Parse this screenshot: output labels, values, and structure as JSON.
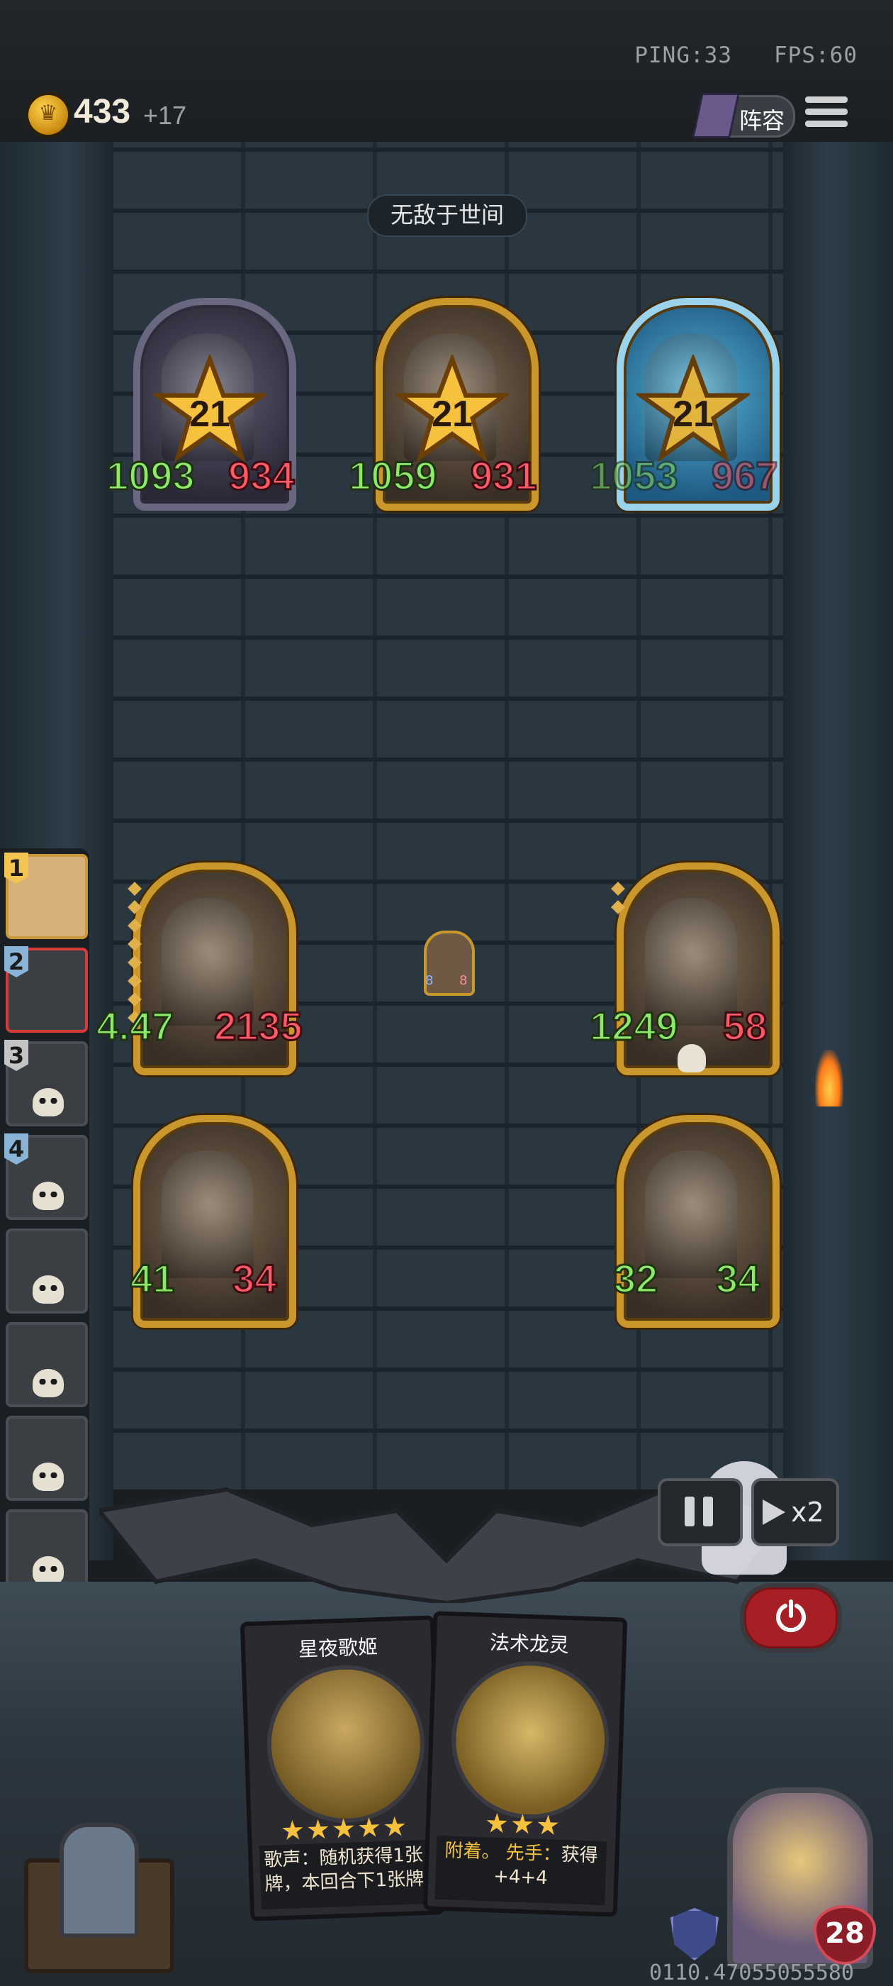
{
  "status": {
    "ping": "PING:33",
    "fps": "FPS:60"
  },
  "economy": {
    "gold": "433",
    "gold_income": "+17",
    "coin_icon": "crown-coin-icon"
  },
  "topbar": {
    "lineup_label": "阵容",
    "menu_icon": "hamburger-menu-icon"
  },
  "board_title": "无敌于世间",
  "enemy_units": [
    {
      "level": "21",
      "attack": "1093",
      "health": "934",
      "frame": "purple"
    },
    {
      "level": "21",
      "attack": "1059",
      "health": "931",
      "frame": "gold"
    },
    {
      "level": "21",
      "attack": "1053",
      "health": "967",
      "frame": "frozen"
    }
  ],
  "player_units": [
    {
      "attack": "4.47",
      "health": "2135"
    },
    {
      "attack": "1249",
      "health": "58"
    },
    {
      "attack": "41",
      "health": "34"
    },
    {
      "attack": "32",
      "health": "34"
    }
  ],
  "mini_unit": {
    "attack": "8",
    "health": "8"
  },
  "roster": [
    {
      "number": "1"
    },
    {
      "number": "2"
    },
    {
      "number": "3"
    },
    {
      "number": "4"
    },
    {
      "number": ""
    },
    {
      "number": ""
    },
    {
      "number": ""
    },
    {
      "number": ""
    }
  ],
  "controls": {
    "speed_label": "x2",
    "pause_icon": "pause-icon",
    "power_icon": "power-icon"
  },
  "hand": [
    {
      "name": "星夜歌姬",
      "stars": "★★★★★",
      "desc_line1": "歌声：随机获得1张",
      "desc_line2": "牌，本回合下1张牌",
      "desc_line3": "…"
    },
    {
      "name": "法术龙灵",
      "stars": "★★★",
      "desc_keyword": "附着。",
      "desc_keyword2": "先手：",
      "desc_line1": "获得",
      "desc_line2": "+4+4"
    }
  ],
  "player": {
    "health": "28"
  },
  "seed": "0110.47055055580"
}
